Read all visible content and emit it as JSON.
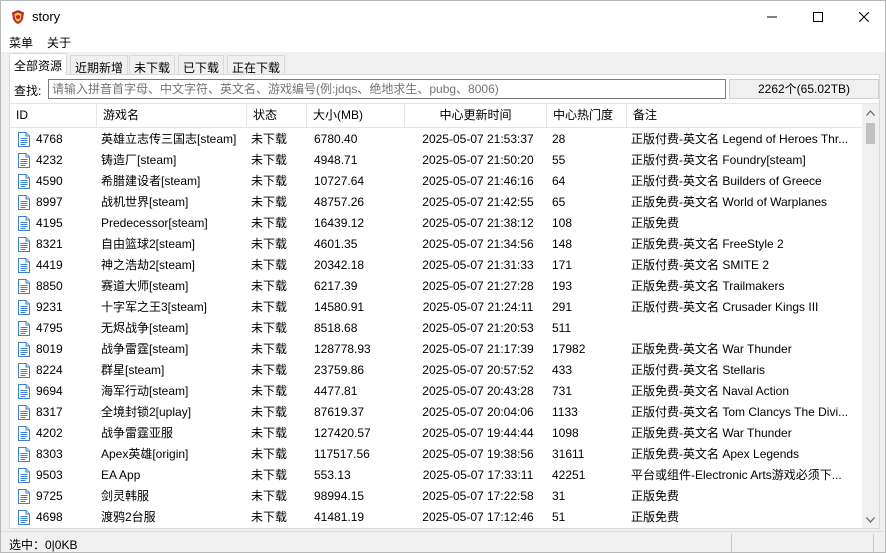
{
  "window": {
    "title": "story"
  },
  "menu": {
    "items": [
      "菜单",
      "关于"
    ]
  },
  "tabs": [
    "全部资源",
    "近期新增",
    "未下载",
    "已下载",
    "正在下载"
  ],
  "search": {
    "label": "查找:",
    "placeholder": "请输入拼音首字母、中文字符、英文名、游戏编号(例:jdqs、绝地求生、pubg、8006)",
    "value": ""
  },
  "count": "2262个(65.02TB)",
  "table": {
    "headers": [
      "ID",
      "游戏名",
      "状态",
      "大小(MB)",
      "中心更新时间",
      "中心热门度",
      "备注"
    ],
    "rows": [
      {
        "id": "4768",
        "name": "英雄立志传三国志[steam]",
        "status": "未下载",
        "size": "6780.40",
        "time": "2025-05-07 21:53:37",
        "hot": "28",
        "note": "正版付费-英文名 Legend of Heroes Thr..."
      },
      {
        "id": "4232",
        "name": "铸造厂[steam]",
        "status": "未下载",
        "size": "4948.71",
        "time": "2025-05-07 21:50:20",
        "hot": "55",
        "note": "正版付费-英文名 Foundry[steam]"
      },
      {
        "id": "4590",
        "name": "希腊建设者[steam]",
        "status": "未下载",
        "size": "10727.64",
        "time": "2025-05-07 21:46:16",
        "hot": "64",
        "note": "正版付费-英文名 Builders of Greece"
      },
      {
        "id": "8997",
        "name": "战机世界[steam]",
        "status": "未下载",
        "size": "48757.26",
        "time": "2025-05-07 21:42:55",
        "hot": "65",
        "note": "正版免费-英文名 World of Warplanes"
      },
      {
        "id": "4195",
        "name": "Predecessor[steam]",
        "status": "未下载",
        "size": "16439.12",
        "time": "2025-05-07 21:38:12",
        "hot": "108",
        "note": "正版免费"
      },
      {
        "id": "8321",
        "name": "自由篮球2[steam]",
        "status": "未下载",
        "size": "4601.35",
        "time": "2025-05-07 21:34:56",
        "hot": "148",
        "note": "正版免费-英文名 FreeStyle 2"
      },
      {
        "id": "4419",
        "name": "神之浩劫2[steam]",
        "status": "未下载",
        "size": "20342.18",
        "time": "2025-05-07 21:31:33",
        "hot": "171",
        "note": "正版付费-英文名 SMITE 2"
      },
      {
        "id": "8850",
        "name": "赛道大师[steam]",
        "status": "未下载",
        "size": "6217.39",
        "time": "2025-05-07 21:27:28",
        "hot": "193",
        "note": "正版免费-英文名 Trailmakers"
      },
      {
        "id": "9231",
        "name": "十字军之王3[steam]",
        "status": "未下载",
        "size": "14580.91",
        "time": "2025-05-07 21:24:11",
        "hot": "291",
        "note": "正版付费-英文名 Crusader Kings III"
      },
      {
        "id": "4795",
        "name": "无烬战争[steam]",
        "status": "未下载",
        "size": "8518.68",
        "time": "2025-05-07 21:20:53",
        "hot": "511",
        "note": ""
      },
      {
        "id": "8019",
        "name": "战争雷霆[steam]",
        "status": "未下载",
        "size": "128778.93",
        "time": "2025-05-07 21:17:39",
        "hot": "17982",
        "note": "正版免费-英文名 War Thunder"
      },
      {
        "id": "8224",
        "name": "群星[steam]",
        "status": "未下载",
        "size": "23759.86",
        "time": "2025-05-07 20:57:52",
        "hot": "433",
        "note": "正版付费-英文名 Stellaris"
      },
      {
        "id": "9694",
        "name": "海军行动[steam]",
        "status": "未下载",
        "size": "4477.81",
        "time": "2025-05-07 20:43:28",
        "hot": "731",
        "note": "正版免费-英文名 Naval Action"
      },
      {
        "id": "8317",
        "name": "全境封锁2[uplay]",
        "status": "未下载",
        "size": "87619.37",
        "time": "2025-05-07 20:04:06",
        "hot": "1133",
        "note": "正版付费-英文名 Tom Clancys The Divi..."
      },
      {
        "id": "4202",
        "name": "战争雷霆亚服",
        "status": "未下载",
        "size": "127420.57",
        "time": "2025-05-07 19:44:44",
        "hot": "1098",
        "note": "正版免费-英文名 War Thunder"
      },
      {
        "id": "8303",
        "name": "Apex英雄[origin]",
        "status": "未下载",
        "size": "117517.56",
        "time": "2025-05-07 19:38:56",
        "hot": "31611",
        "note": "正版免费-英文名 Apex Legends"
      },
      {
        "id": "9503",
        "name": "EA App",
        "status": "未下载",
        "size": "553.13",
        "time": "2025-05-07 17:33:11",
        "hot": "42251",
        "note": "平台或组件-Electronic Arts游戏必须下..."
      },
      {
        "id": "9725",
        "name": "剑灵韩服",
        "status": "未下载",
        "size": "98994.15",
        "time": "2025-05-07 17:22:58",
        "hot": "31",
        "note": "正版免费"
      },
      {
        "id": "4698",
        "name": "渡鸦2台服",
        "status": "未下载",
        "size": "41481.19",
        "time": "2025-05-07 17:12:46",
        "hot": "51",
        "note": "正版免费"
      }
    ]
  },
  "status": {
    "text": "选中：0|0KB"
  },
  "icons": {
    "app": "shield-app-icon",
    "file": "file-icon"
  }
}
